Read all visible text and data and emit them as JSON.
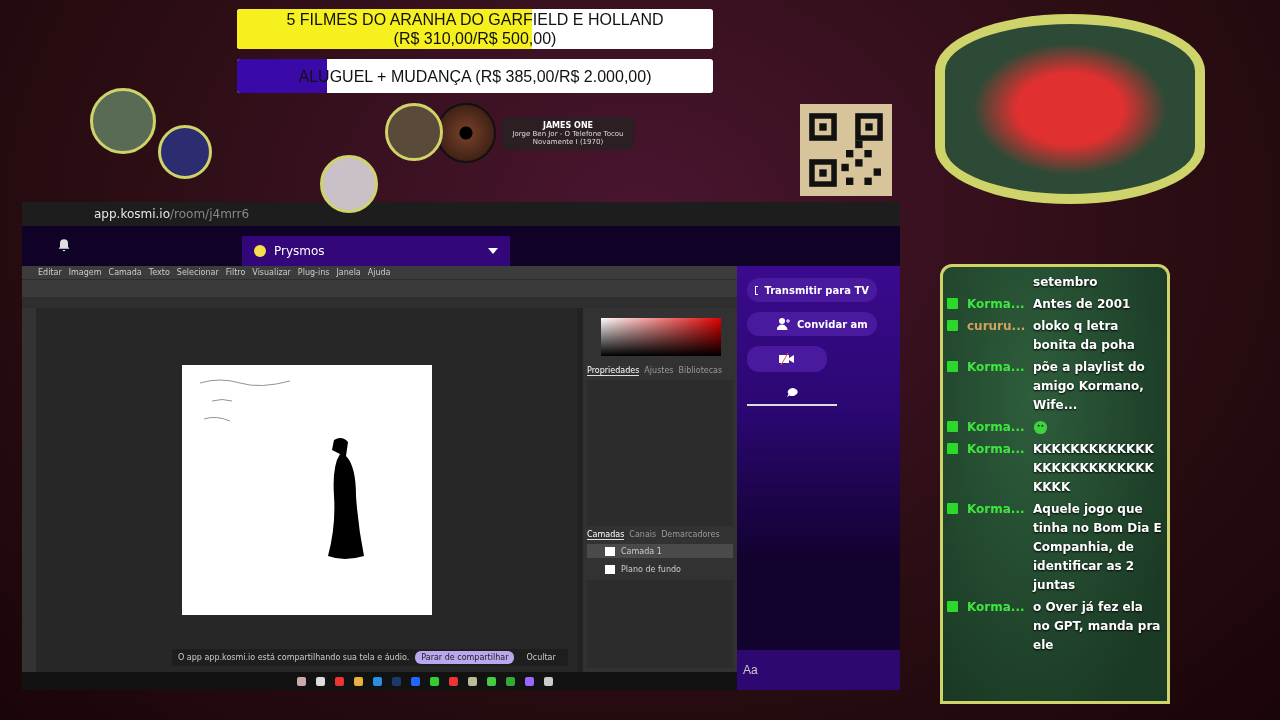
{
  "goals": [
    {
      "label": "5 FILMES DO ARANHA DO GARFIELD E HOLLAND",
      "amount": "(R$ 310,00/R$ 500,00)",
      "level": 0.62,
      "color": "#f5f01e"
    },
    {
      "label": "ALUGUEL + MUDANÇA (R$ 385,00/R$ 2.000,00)",
      "level": 0.19,
      "color": "#3a0aa8"
    }
  ],
  "now_playing": {
    "station": "JAMES ONE",
    "track": "Jorge Ben Jor - O Telefone Tocou",
    "album": "Novamente I (1970)"
  },
  "browser": {
    "url_host": "app.kosmi.io",
    "url_path": "/room/j4mrr6"
  },
  "room": {
    "name": "Prysmos"
  },
  "photoshop": {
    "menu": [
      "Editar",
      "Imagem",
      "Camada",
      "Texto",
      "Selecionar",
      "Filtro",
      "Visualizar",
      "Plug-ins",
      "Janela",
      "Ajuda"
    ],
    "panel_tabs": [
      {
        "label": "Propriedades",
        "selected": true
      },
      {
        "label": "Ajustes",
        "selected": false
      },
      {
        "label": "Bibliotecas",
        "selected": false
      }
    ],
    "layer_tabs": [
      {
        "label": "Camadas",
        "selected": true
      },
      {
        "label": "Canais",
        "selected": false
      },
      {
        "label": "Demarcadores",
        "selected": false
      }
    ],
    "layers": [
      {
        "name": "Camada 1",
        "selected": true
      },
      {
        "name": "Plano de fundo",
        "selected": false
      }
    ]
  },
  "share_notice": {
    "text": "O app app.kosmi.io está compartilhando sua tela e áudio.",
    "stop": "Parar de compartilhar",
    "hide": "Ocultar"
  },
  "sidebar": {
    "buttons": [
      "Transmitir para TV",
      "Convidar am"
    ],
    "input_placeholder": "Aa"
  },
  "chat": [
    {
      "kind": "continued",
      "text": "setembro"
    },
    {
      "kind": "message",
      "user": "Korma...",
      "color": "#3ee63e",
      "text": "Antes de 2001"
    },
    {
      "kind": "message",
      "user": "cururu...",
      "color": "#d2a25c",
      "text": "oloko q letra bonita da poha"
    },
    {
      "kind": "message",
      "user": "Korma...",
      "color": "#3ee63e",
      "text": "põe a playlist do amigo Kormano, Wife..."
    },
    {
      "kind": "emote",
      "user": "Korma...",
      "color": "#3ee63e"
    },
    {
      "kind": "message",
      "user": "Korma...",
      "color": "#3ee63e",
      "text": "KKKKKKKKKKKKKKKKKKKKKKKKKKKKKK"
    },
    {
      "kind": "message",
      "user": "Korma...",
      "color": "#3ee63e",
      "text": "Aquele jogo que tinha no Bom Dia E Companhia, de identificar as 2 juntas"
    },
    {
      "kind": "message",
      "user": "Korma...",
      "color": "#3ee63e",
      "text": "o Over já fez ela no GPT, manda pra ele"
    }
  ]
}
